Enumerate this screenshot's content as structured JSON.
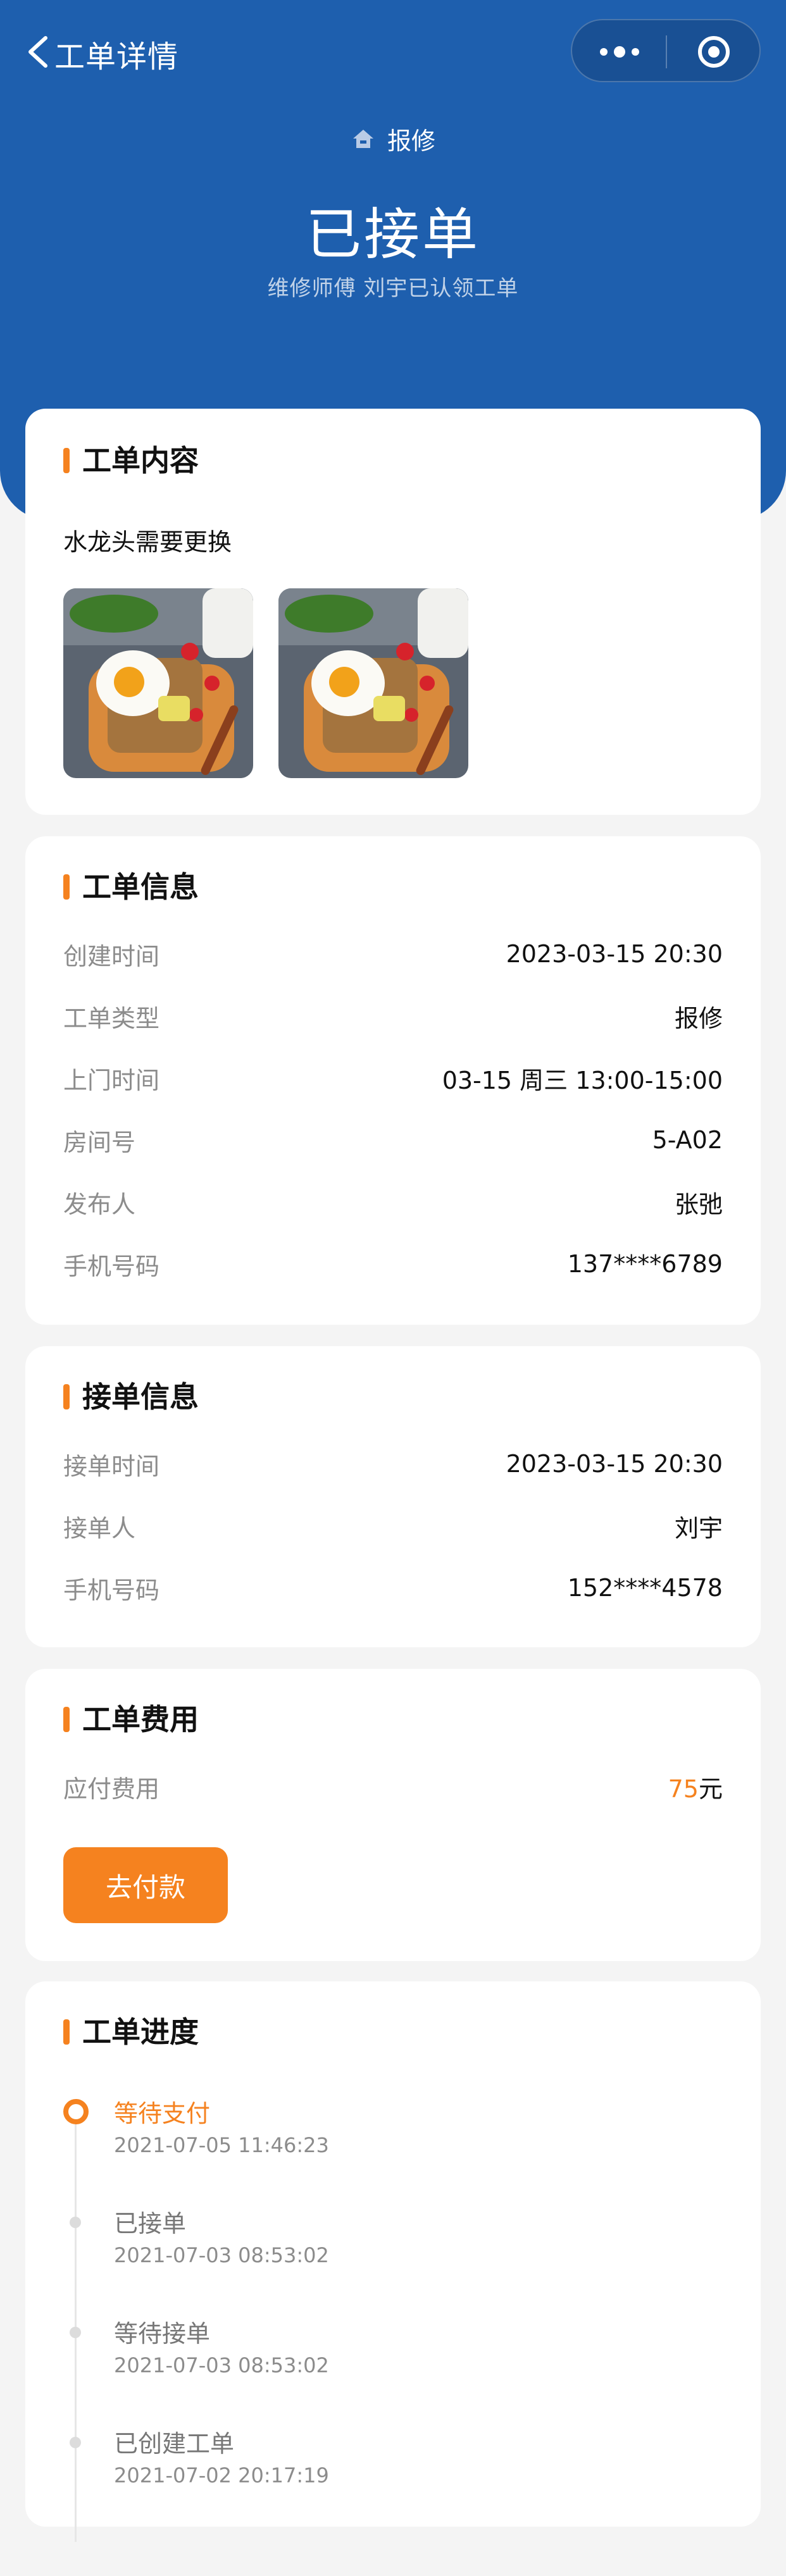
{
  "nav": {
    "title": "工单详情"
  },
  "header": {
    "type_label": "报修",
    "status": "已接单",
    "subtitle": "维修师傅 刘宇已认领工单"
  },
  "content_card": {
    "title": "工单内容",
    "description": "水龙头需要更换",
    "image_count": 2
  },
  "info_card": {
    "title": "工单信息",
    "rows": [
      {
        "label": "创建时间",
        "value": "2023-03-15 20:30"
      },
      {
        "label": "工单类型",
        "value": "报修"
      },
      {
        "label": "上门时间",
        "value": "03-15 周三 13:00-15:00"
      },
      {
        "label": "房间号",
        "value": "5-A02"
      },
      {
        "label": "发布人",
        "value": "张弛"
      },
      {
        "label": "手机号码",
        "value": "137****6789"
      }
    ]
  },
  "accept_card": {
    "title": "接单信息",
    "rows": [
      {
        "label": "接单时间",
        "value": "2023-03-15 20:30"
      },
      {
        "label": "接单人",
        "value": "刘宇"
      },
      {
        "label": "手机号码",
        "value": "152****4578"
      }
    ]
  },
  "fee_card": {
    "title": "工单费用",
    "label": "应付费用",
    "amount": "75",
    "unit": "元",
    "pay_button": "去付款"
  },
  "progress_card": {
    "title": "工单进度",
    "steps": [
      {
        "title": "等待支付",
        "time": "2021-07-05 11:46:23",
        "active": true
      },
      {
        "title": "已接单",
        "time": "2021-07-03 08:53:02",
        "active": false
      },
      {
        "title": "等待接单",
        "time": "2021-07-03 08:53:02",
        "active": false
      },
      {
        "title": "已创建工单",
        "time": "2021-07-02 20:17:19",
        "active": false
      }
    ]
  },
  "colors": {
    "primary_blue": "#1e5fae",
    "accent_orange": "#f5821f",
    "background": "#f4f4f4"
  }
}
